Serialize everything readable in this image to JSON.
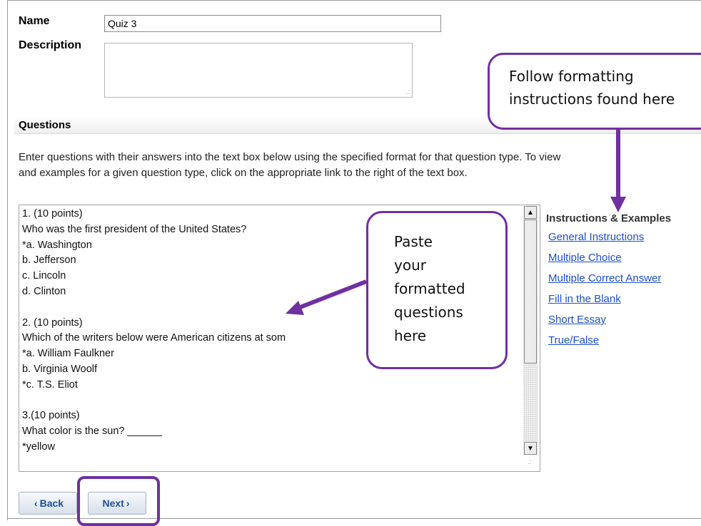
{
  "form": {
    "name_label": "Name",
    "name_value": "Quiz 3",
    "description_label": "Description",
    "description_value": ""
  },
  "questions": {
    "section_title": "Questions",
    "help_line1": "Enter questions with their answers into the text box below using the specified format for that question type. To view",
    "help_line2": "and examples for a given question type, click on the appropriate link to the right of the text box.",
    "text": "1. (10 points)\nWho was the first president of the United States?\n*a. Washington\nb. Jefferson\nc. Lincoln\nd. Clinton\n\n2. (10 points)\nWhich of the writers below were American citizens at som\n*a. William Faulkner\nb. Virginia Woolf\n*c. T.S. Eliot\n\n3.(10 points)\nWhat color is the sun? ______\n*yellow"
  },
  "instructions": {
    "title": "Instructions & Examples",
    "links": [
      "General Instructions",
      "Multiple Choice",
      "Multiple Correct Answer",
      "Fill in the Blank",
      "Short Essay",
      "True/False"
    ]
  },
  "buttons": {
    "back_label": "Back",
    "next_label": "Next"
  },
  "callouts": {
    "formatting": "Follow formatting\ninstructions found here",
    "paste": "Paste\nyour\nformatted\nquestions\nhere"
  },
  "colors": {
    "callout_border": "#7030a0",
    "link": "#1c4fc7",
    "button_text": "#1e4f96"
  }
}
